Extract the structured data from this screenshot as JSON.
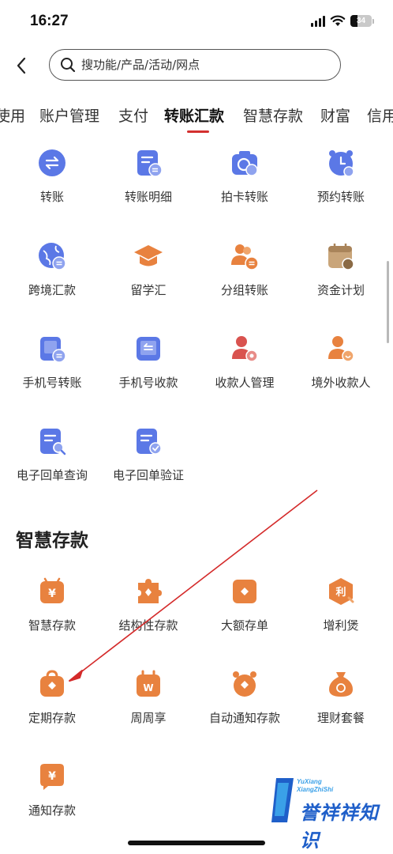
{
  "status_bar": {
    "time": "16:27",
    "battery_percent": 34,
    "battery_label": "34",
    "icons": [
      "signal-icon",
      "wifi-icon",
      "battery-icon"
    ]
  },
  "header": {
    "back_icon": "chevron-left-icon",
    "search_placeholder": "搜功能/产品/活动/网点",
    "search_icon": "search-icon"
  },
  "tabs": [
    {
      "label": "使用"
    },
    {
      "label": "账户管理"
    },
    {
      "label": "支付"
    },
    {
      "label": "转账汇款",
      "active": true
    },
    {
      "label": "智慧存款"
    },
    {
      "label": "财富"
    },
    {
      "label": "信用"
    }
  ],
  "transfer": {
    "items": [
      {
        "label": "转账",
        "icon": "transfer-arrows-icon"
      },
      {
        "label": "转账明细",
        "icon": "transfer-detail-icon"
      },
      {
        "label": "拍卡转账",
        "icon": "camera-card-icon"
      },
      {
        "label": "预约转账",
        "icon": "alarm-clock-icon"
      },
      {
        "label": "跨境汇款",
        "icon": "globe-transfer-icon"
      },
      {
        "label": "留学汇",
        "icon": "graduation-cap-icon"
      },
      {
        "label": "分组转账",
        "icon": "group-transfer-icon"
      },
      {
        "label": "资金计划",
        "icon": "calendar-money-icon"
      },
      {
        "label": "手机号转账",
        "icon": "phone-transfer-icon"
      },
      {
        "label": "手机号收款",
        "icon": "phone-receive-icon"
      },
      {
        "label": "收款人管理",
        "icon": "payee-manage-icon"
      },
      {
        "label": "境外收款人",
        "icon": "overseas-payee-icon"
      },
      {
        "label": "电子回单查询",
        "icon": "receipt-search-icon"
      },
      {
        "label": "电子回单验证",
        "icon": "receipt-verify-icon"
      }
    ]
  },
  "deposit": {
    "title": "智慧存款",
    "items": [
      {
        "label": "智慧存款",
        "icon": "smart-deposit-icon"
      },
      {
        "label": "结构性存款",
        "icon": "structured-deposit-icon"
      },
      {
        "label": "大额存单",
        "icon": "large-cd-icon"
      },
      {
        "label": "增利煲",
        "icon": "zenglibao-icon"
      },
      {
        "label": "定期存款",
        "icon": "fixed-deposit-icon"
      },
      {
        "label": "周周享",
        "icon": "weekly-calendar-icon"
      },
      {
        "label": "自动通知存款",
        "icon": "auto-notice-deposit-icon"
      },
      {
        "label": "理财套餐",
        "icon": "wealth-package-icon"
      },
      {
        "label": "通知存款",
        "icon": "notice-deposit-icon"
      }
    ]
  },
  "colors": {
    "blue_icon": "#5b78e6",
    "orange_icon": "#e8823f",
    "red_icon": "#d9534f",
    "accent": "#d3302f",
    "annotation_arrow": "#d42a2a"
  },
  "watermark": {
    "line1": "YuXiang",
    "line2": "XiangZhiShi",
    "title": "誉祥祥知识"
  }
}
